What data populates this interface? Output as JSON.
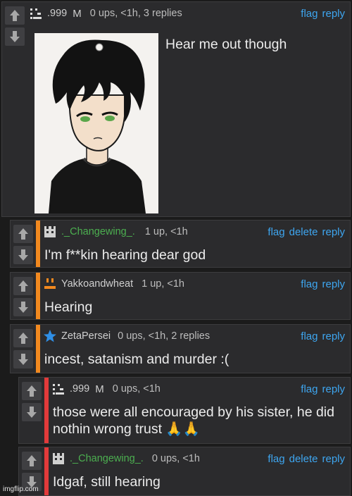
{
  "comments": [
    {
      "username": ".999",
      "badge": "M",
      "meta": "0 ups, <1h, 3 replies",
      "actions": [
        "flag",
        "reply"
      ],
      "text": "Hear me out though"
    },
    {
      "username": "._Changewing_.",
      "meta": "1 up, <1h",
      "actions": [
        "flag",
        "delete",
        "reply"
      ],
      "text": "I'm f**kin hearing dear god"
    },
    {
      "username": "Yakkoandwheat",
      "meta": "1 up, <1h",
      "actions": [
        "flag",
        "reply"
      ],
      "text": "Hearing"
    },
    {
      "username": "ZetaPersei",
      "meta": "0 ups, <1h, 2 replies",
      "actions": [
        "flag",
        "reply"
      ],
      "text": "incest, satanism and murder :("
    },
    {
      "username": ".999",
      "badge": "M",
      "meta": "0 ups, <1h",
      "actions": [
        "flag",
        "reply"
      ],
      "text_line1": "those were all encouraged by his sister, he did",
      "text_line2": "nothin wrong trust 🙏🙏"
    },
    {
      "username": "._Changewing_.",
      "meta": "0 ups, <1h",
      "actions": [
        "flag",
        "delete",
        "reply"
      ],
      "text": "Idgaf, still hearing"
    }
  ],
  "watermark": "imgflip.com",
  "colors": {
    "link": "#3ea6f0",
    "depth1_bar": "#f2891f",
    "depth2_bar": "#e23a3a",
    "green_user": "#4caf50"
  },
  "icons": [
    "upvote-arrow-icon",
    "downvote-arrow-icon",
    "pixel-avatar-icon",
    "star-icon"
  ]
}
